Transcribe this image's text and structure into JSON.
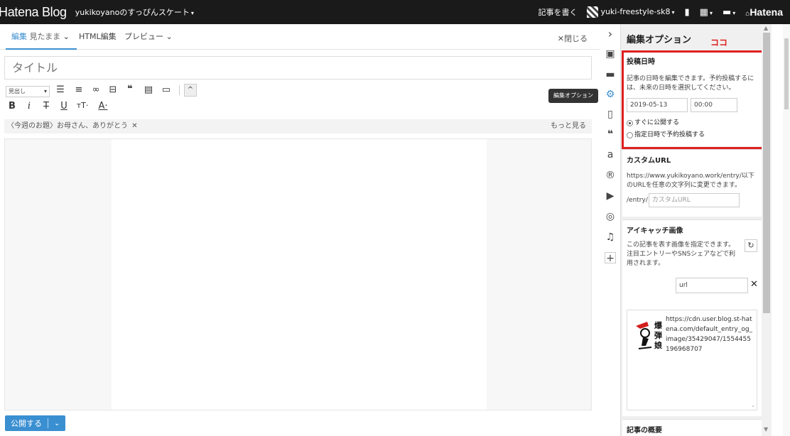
{
  "topbar": {
    "brand": "Hatena Blog",
    "blog_name": "yukikoyanoのすっぴんスケート",
    "write_link": "記事を書く",
    "user": "yuki-freestyle-sk8",
    "hatena_logo": "Hatena"
  },
  "tabs": {
    "edit_label": "編集",
    "edit_mode": "見たまま",
    "html_label": "HTML編集",
    "preview_label": "プレビュー",
    "close_label": "閉じる"
  },
  "editor": {
    "title_placeholder": "タイトル",
    "heading_select": "見出し",
    "topic_text": "〈今週のお題〉お母さん、ありがとう",
    "topic_more": "もっと見る"
  },
  "publish": {
    "label": "公開する"
  },
  "tooltip": {
    "text": "編集オプション"
  },
  "panel": {
    "title": "編集オプション",
    "annotation": "ココ",
    "post_date": {
      "heading": "投稿日時",
      "desc": "記事の日時を編集できます。予約投稿するには、未来の日時を選択してください。",
      "date": "2019-05-13",
      "time": "00:00",
      "opt_now": "すぐに公開する",
      "opt_scheduled": "指定日時で予約投稿する"
    },
    "custom_url": {
      "heading": "カスタムURL",
      "desc": "https://www.yukikoyano.work/entry/以下のURLを任意の文字列に変更できます。",
      "prefix": "/entry/",
      "placeholder": "カスタムURL"
    },
    "eyecatch": {
      "heading": "アイキャッチ画像",
      "desc": "この記事を表す画像を指定できます。注目エントリーやSNSシェアなどで利用されます。",
      "url_value": "url",
      "image_url": "https://cdn.user.blog.st-hatena.com/default_entry_og_image/35429047/1554455196968707"
    },
    "summary": {
      "heading": "記事の概要"
    }
  },
  "colors": {
    "accent": "#3a8fd1",
    "highlight": "#e02020",
    "topbar": "#1a1a1a"
  }
}
